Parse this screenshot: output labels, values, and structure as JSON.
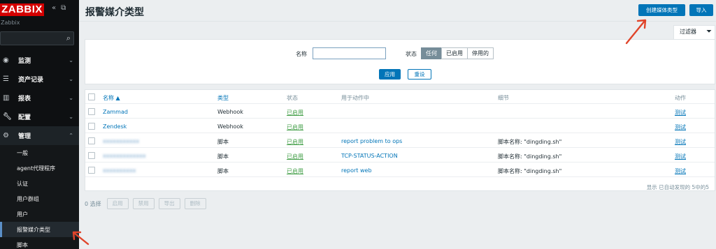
{
  "app": {
    "logo": "ZABBIX",
    "server": "Zabbix"
  },
  "sidebar": {
    "items": [
      {
        "label": "监测",
        "icon": "eye-icon"
      },
      {
        "label": "资产记录",
        "icon": "list-icon"
      },
      {
        "label": "报表",
        "icon": "chart-icon"
      },
      {
        "label": "配置",
        "icon": "wrench-icon"
      },
      {
        "label": "管理",
        "icon": "gear-icon"
      }
    ],
    "submenu": [
      "一般",
      "agent代理程序",
      "认证",
      "用户群组",
      "用户",
      "报警媒介类型",
      "脚本"
    ]
  },
  "header": {
    "title": "报警媒介类型",
    "create_label": "创建媒体类型",
    "import_label": "导入"
  },
  "filter": {
    "tab_label": "过滤器",
    "name_label": "名称",
    "name_value": "",
    "status_label": "状态",
    "status_options": [
      "任何",
      "已启用",
      "停用的"
    ],
    "apply_label": "应用",
    "reset_label": "重设"
  },
  "table": {
    "headers": {
      "name": "名称 ▲",
      "type": "类型",
      "status": "状态",
      "used": "用于动作中",
      "details": "细节",
      "action": "动作"
    },
    "rows": [
      {
        "name": "Zammad",
        "type": "Webhook",
        "status": "已启用",
        "used": "",
        "details": "",
        "action": "测试"
      },
      {
        "name": "Zendesk",
        "type": "Webhook",
        "status": "已启用",
        "used": "",
        "details": "",
        "action": "测试"
      },
      {
        "name": "xxxxxxxxxxx",
        "type": "脚本",
        "status": "已启用",
        "used": "report problem to ops",
        "details": "脚本名称: \"dingding.sh\"",
        "action": "测试"
      },
      {
        "name": "xxxxxxxxxxxxx",
        "type": "脚本",
        "status": "已启用",
        "used": "TCP-STATUS-ACTION",
        "details": "脚本名称: \"dingding.sh\"",
        "action": "测试"
      },
      {
        "name": "xxxxxxxxxx",
        "type": "脚本",
        "status": "已启用",
        "used": "report web",
        "details": "脚本名称: \"dingding.sh\"",
        "action": "测试"
      }
    ],
    "footer": "显示 已自动发现的 5中的5"
  },
  "bottom": {
    "selected": "0 选择",
    "buttons": [
      "启用",
      "禁用",
      "导出",
      "删除"
    ]
  },
  "colors": {
    "accent": "#0275b8",
    "sidebar_bg": "#0e1012",
    "logo_red": "#d40000",
    "enabled_green": "#429e47",
    "annotation_red": "#e0442a"
  }
}
